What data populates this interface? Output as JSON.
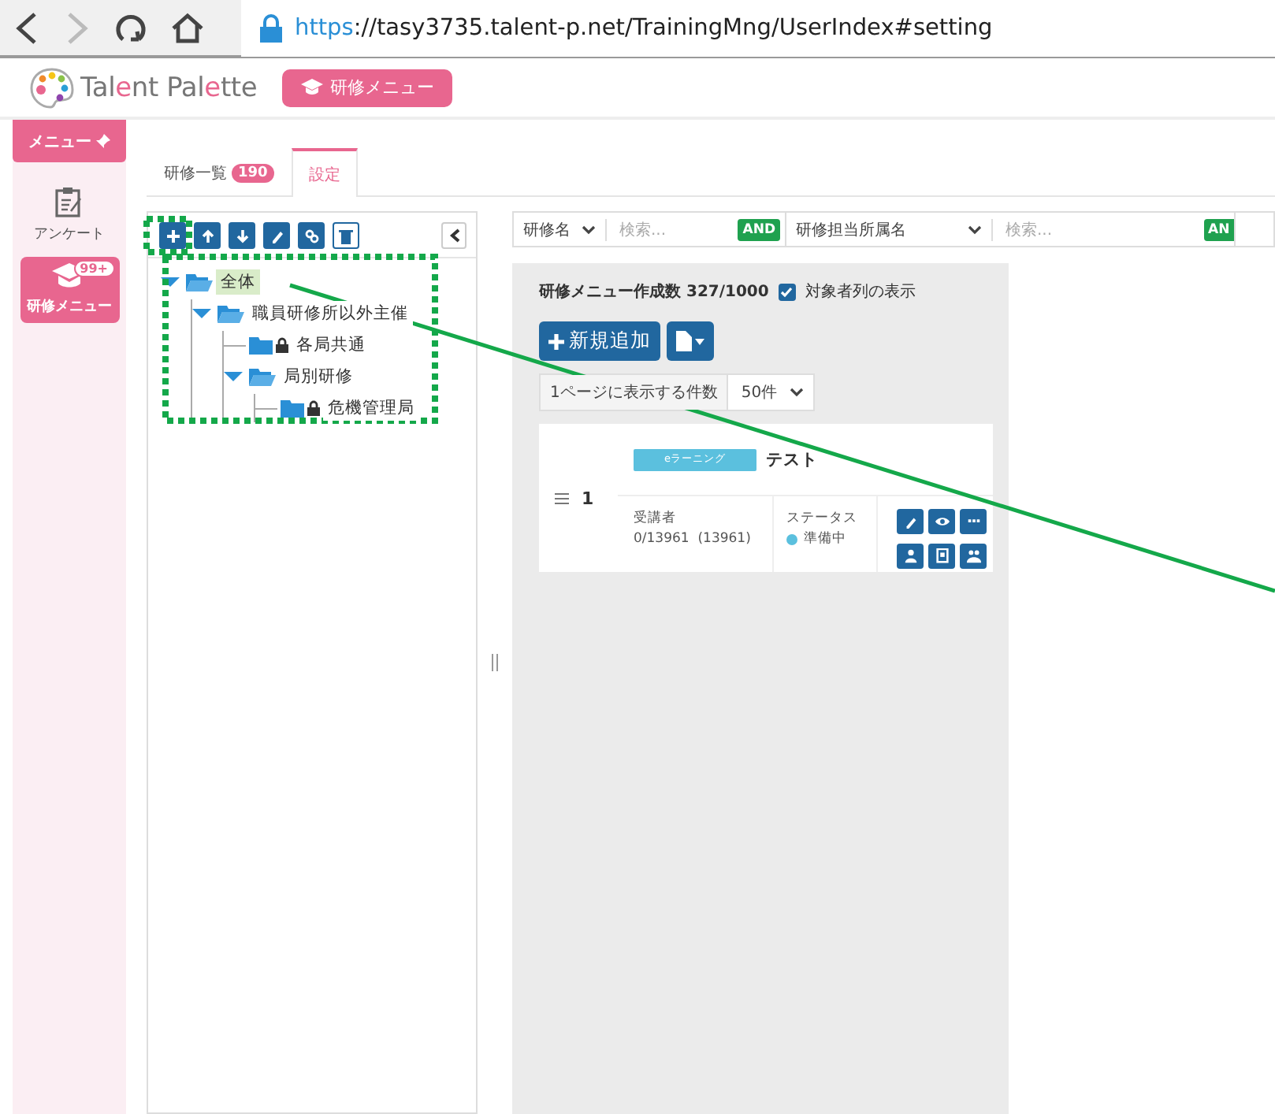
{
  "browser": {
    "url_scheme": "https",
    "url_rest": "://tasy3735.talent-p.net/TrainingMng/UserIndex#setting"
  },
  "header": {
    "logo_start": "Tal",
    "logo_e1": "e",
    "logo_mid": "nt Pal",
    "logo_e2": "e",
    "logo_end": "tte",
    "menu_button": "研修メニュー"
  },
  "sidebar": {
    "title": "メニュー",
    "items": [
      {
        "label": "アンケート",
        "kind": "survey",
        "selected": false
      },
      {
        "label": "研修メニュー",
        "kind": "training",
        "badge": "99+",
        "selected": true
      }
    ]
  },
  "tabs": [
    {
      "label": "研修一覧",
      "badge": "190",
      "selected": false
    },
    {
      "label": "設定",
      "selected": true
    }
  ],
  "tree": {
    "items": [
      {
        "label": "全体",
        "expanded": true,
        "selected": true,
        "children": [
          {
            "label": "職員研修所以外主催",
            "expanded": true,
            "selected": false,
            "children": [
              {
                "label": "各局共通",
                "selected": false,
                "locked": true
              },
              {
                "label": "局別研修",
                "expanded": true,
                "selected": false,
                "children": [
                  {
                    "label": "危機管理局",
                    "selected": false,
                    "locked": true
                  }
                ]
              }
            ]
          }
        ]
      }
    ]
  },
  "filters": [
    {
      "field": "研修名",
      "placeholder": "検索...",
      "operator": "AND"
    },
    {
      "field": "研修担当所属名",
      "placeholder": "検索...",
      "operator": "AN"
    }
  ],
  "panel": {
    "count_label": "研修メニュー作成数 327/1000",
    "show_targets": {
      "label": "対象者列の表示",
      "checked": true
    },
    "add_button": "新規追加",
    "per_page_label": "1ページに表示する件数",
    "per_page": "50件"
  },
  "menus": [
    {
      "number": "1",
      "category": "eラーニング",
      "title": "テスト",
      "participants_label": "受講者",
      "participants": "0/13961  (13961)",
      "status_label": "ステータス",
      "status": "準備中",
      "color": "#5bc0de"
    }
  ]
}
